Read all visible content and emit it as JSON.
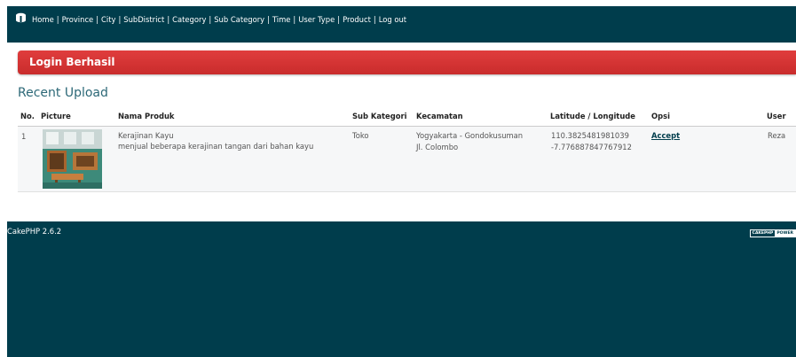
{
  "nav": {
    "links": [
      "Home",
      "Province",
      "City",
      "SubDistrict",
      "Category",
      "Sub Category",
      "Time",
      "User Type",
      "Product",
      "Log out"
    ],
    "separator": "|"
  },
  "flash": {
    "message": "Login Berhasil"
  },
  "section": {
    "title": "Recent Upload"
  },
  "table": {
    "headers": [
      "No.",
      "Picture",
      "Nama Produk",
      "Sub Kategori",
      "Kecamatan",
      "Latitude / Longitude",
      "Opsi",
      "User"
    ],
    "rows": [
      {
        "no": "1",
        "product_name": "Kerajinan Kayu",
        "product_desc": "menjual beberapa kerajinan tangan dari bahan kayu",
        "sub_kategori": "Toko",
        "kecamatan": "Yogyakarta - Gondokusuman",
        "address": "Jl. Colombo",
        "latitude": "110.3825481981039",
        "longitude": "-7.776887847767912",
        "opsi": "Accept",
        "user": "Reza"
      }
    ]
  },
  "footer": {
    "version": "CakePHP 2.6.2",
    "badge_left": "CAKEPHP",
    "badge_right": "POWER"
  },
  "colors": {
    "primary": "#003d4c",
    "flash": "#d03333",
    "heading": "#2c6877"
  }
}
